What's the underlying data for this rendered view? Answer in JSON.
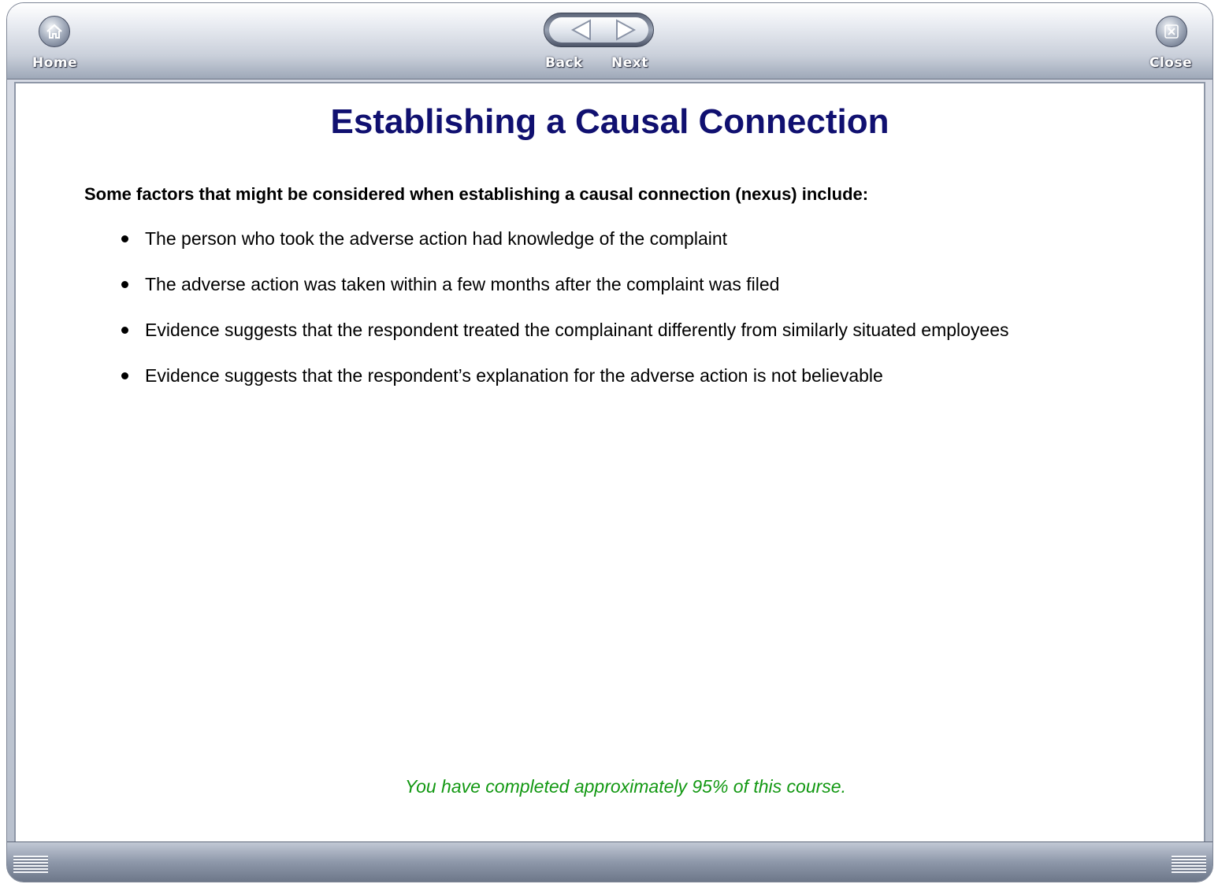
{
  "toolbar": {
    "home_label": "Home",
    "back_label": "Back",
    "next_label": "Next",
    "close_label": "Close"
  },
  "page": {
    "title": "Establishing a Causal Connection",
    "intro": "Some factors that might be considered when establishing a causal connection (nexus) include:",
    "bullets": [
      "The person who took the adverse action had knowledge of the complaint",
      "The adverse action was taken within a few months after the complaint was filed",
      "Evidence suggests that the respondent treated the complainant differently from similarly situated employees",
      "Evidence suggests that the respondent’s explanation for the adverse action is not believable"
    ],
    "progress_text": "You have completed approximately 95% of this course."
  },
  "colors": {
    "title": "#101070",
    "progress": "#129812"
  },
  "icons": {
    "home": "home-icon",
    "back": "back-arrow-icon",
    "next": "next-arrow-icon",
    "close": "close-icon",
    "grip": "resize-grip-icon"
  }
}
